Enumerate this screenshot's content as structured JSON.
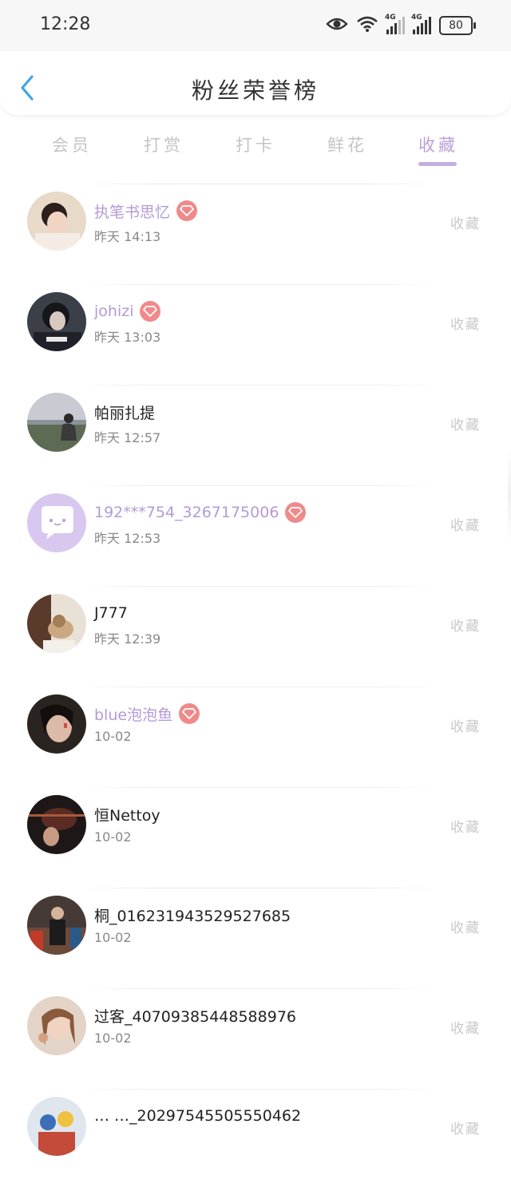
{
  "status_bar": {
    "time": "12:28",
    "network_1": "4G",
    "network_2": "4G",
    "battery": "80"
  },
  "header": {
    "title": "粉丝荣誉榜"
  },
  "tabs": [
    {
      "label": "会员",
      "active": false
    },
    {
      "label": "打赏",
      "active": false
    },
    {
      "label": "打卡",
      "active": false
    },
    {
      "label": "鲜花",
      "active": false
    },
    {
      "label": "收藏",
      "active": true
    }
  ],
  "colors": {
    "accent": "#b9a2d8",
    "vip_name": "#b39bd6",
    "vip_badge": "#f08a8a",
    "muted_text": "#888888",
    "action_text": "#c9c9c9"
  },
  "fans": [
    {
      "name": "执笔书思忆",
      "time": "昨天 14:13",
      "vip": true,
      "action": "收藏",
      "avatar": "photo-portrait"
    },
    {
      "name": "johizi",
      "time": "昨天 13:03",
      "vip": true,
      "action": "收藏",
      "avatar": "photo-portrait"
    },
    {
      "name": "帕丽扎提",
      "time": "昨天 12:57",
      "vip": false,
      "action": "收藏",
      "avatar": "photo-landscape"
    },
    {
      "name": "192***754_3267175006",
      "time": "昨天 12:53",
      "vip": true,
      "action": "收藏",
      "avatar": "default-chat-avatar"
    },
    {
      "name": "J777",
      "time": "昨天 12:39",
      "vip": false,
      "action": "收藏",
      "avatar": "photo-pet"
    },
    {
      "name": "blue泡泡鱼",
      "time": "10-02",
      "vip": true,
      "action": "收藏",
      "avatar": "photo-portrait"
    },
    {
      "name": "恒Nettoy",
      "time": "10-02",
      "vip": false,
      "action": "收藏",
      "avatar": "photo-dark"
    },
    {
      "name": "桐_016231943529527685",
      "time": "10-02",
      "vip": false,
      "action": "收藏",
      "avatar": "photo-people"
    },
    {
      "name": "过客_40709385448588976",
      "time": "10-02",
      "vip": false,
      "action": "收藏",
      "avatar": "photo-portrait"
    },
    {
      "name": "…  …_20297545505550462",
      "time": "",
      "vip": false,
      "action": "收藏",
      "avatar": "photo-cartoon"
    }
  ]
}
